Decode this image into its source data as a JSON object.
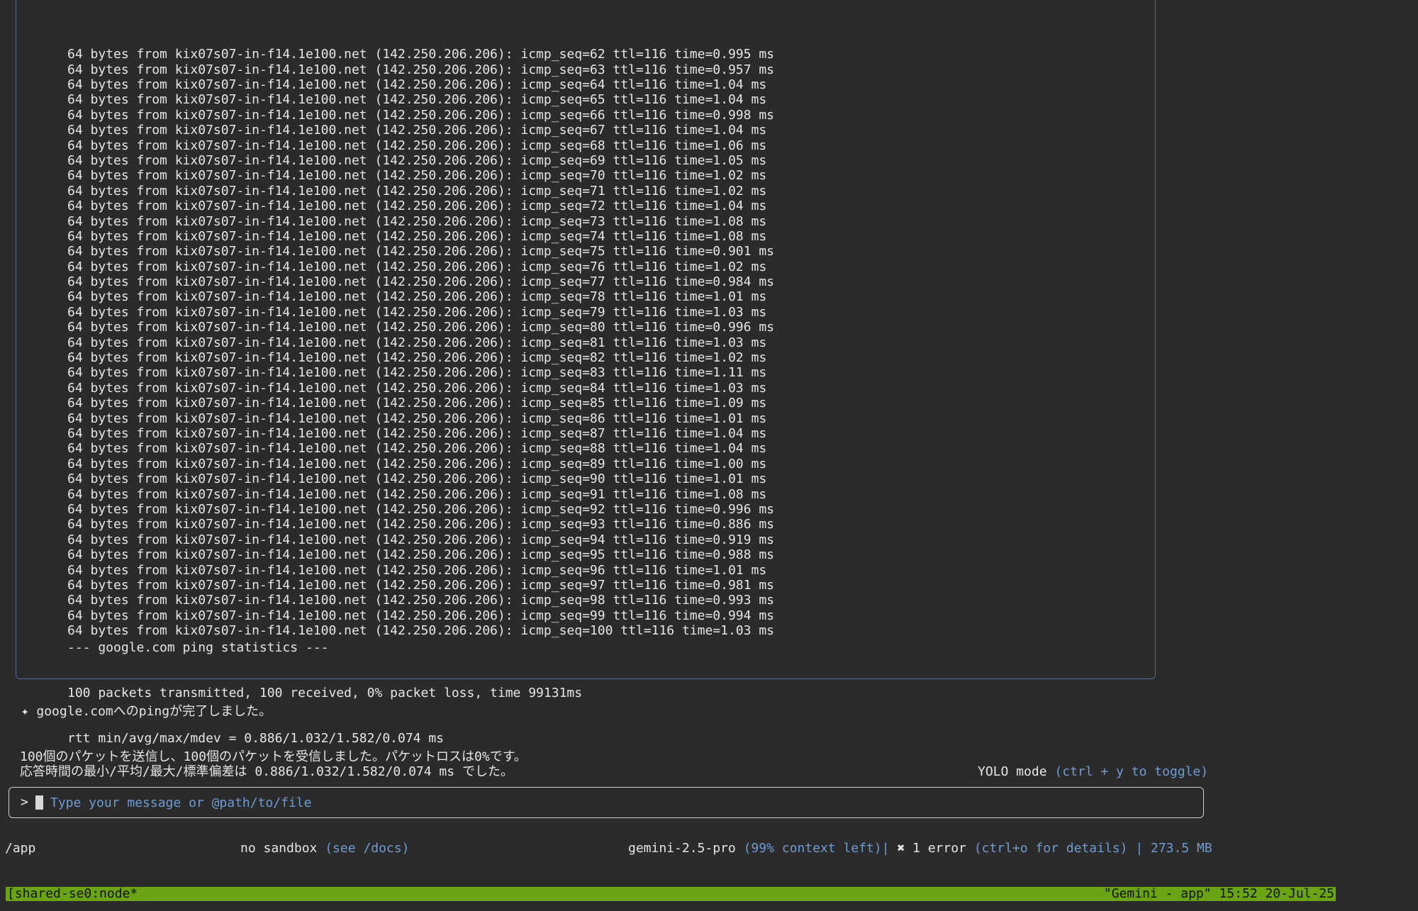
{
  "tool_output": {
    "ping_lines": [
      "64 bytes from kix07s07-in-f14.1e100.net (142.250.206.206): icmp_seq=62 ttl=116 time=0.995 ms",
      "64 bytes from kix07s07-in-f14.1e100.net (142.250.206.206): icmp_seq=63 ttl=116 time=0.957 ms",
      "64 bytes from kix07s07-in-f14.1e100.net (142.250.206.206): icmp_seq=64 ttl=116 time=1.04 ms",
      "64 bytes from kix07s07-in-f14.1e100.net (142.250.206.206): icmp_seq=65 ttl=116 time=1.04 ms",
      "64 bytes from kix07s07-in-f14.1e100.net (142.250.206.206): icmp_seq=66 ttl=116 time=0.998 ms",
      "64 bytes from kix07s07-in-f14.1e100.net (142.250.206.206): icmp_seq=67 ttl=116 time=1.04 ms",
      "64 bytes from kix07s07-in-f14.1e100.net (142.250.206.206): icmp_seq=68 ttl=116 time=1.06 ms",
      "64 bytes from kix07s07-in-f14.1e100.net (142.250.206.206): icmp_seq=69 ttl=116 time=1.05 ms",
      "64 bytes from kix07s07-in-f14.1e100.net (142.250.206.206): icmp_seq=70 ttl=116 time=1.02 ms",
      "64 bytes from kix07s07-in-f14.1e100.net (142.250.206.206): icmp_seq=71 ttl=116 time=1.02 ms",
      "64 bytes from kix07s07-in-f14.1e100.net (142.250.206.206): icmp_seq=72 ttl=116 time=1.04 ms",
      "64 bytes from kix07s07-in-f14.1e100.net (142.250.206.206): icmp_seq=73 ttl=116 time=1.08 ms",
      "64 bytes from kix07s07-in-f14.1e100.net (142.250.206.206): icmp_seq=74 ttl=116 time=1.08 ms",
      "64 bytes from kix07s07-in-f14.1e100.net (142.250.206.206): icmp_seq=75 ttl=116 time=0.901 ms",
      "64 bytes from kix07s07-in-f14.1e100.net (142.250.206.206): icmp_seq=76 ttl=116 time=1.02 ms",
      "64 bytes from kix07s07-in-f14.1e100.net (142.250.206.206): icmp_seq=77 ttl=116 time=0.984 ms",
      "64 bytes from kix07s07-in-f14.1e100.net (142.250.206.206): icmp_seq=78 ttl=116 time=1.01 ms",
      "64 bytes from kix07s07-in-f14.1e100.net (142.250.206.206): icmp_seq=79 ttl=116 time=1.03 ms",
      "64 bytes from kix07s07-in-f14.1e100.net (142.250.206.206): icmp_seq=80 ttl=116 time=0.996 ms",
      "64 bytes from kix07s07-in-f14.1e100.net (142.250.206.206): icmp_seq=81 ttl=116 time=1.03 ms",
      "64 bytes from kix07s07-in-f14.1e100.net (142.250.206.206): icmp_seq=82 ttl=116 time=1.02 ms",
      "64 bytes from kix07s07-in-f14.1e100.net (142.250.206.206): icmp_seq=83 ttl=116 time=1.11 ms",
      "64 bytes from kix07s07-in-f14.1e100.net (142.250.206.206): icmp_seq=84 ttl=116 time=1.03 ms",
      "64 bytes from kix07s07-in-f14.1e100.net (142.250.206.206): icmp_seq=85 ttl=116 time=1.09 ms",
      "64 bytes from kix07s07-in-f14.1e100.net (142.250.206.206): icmp_seq=86 ttl=116 time=1.01 ms",
      "64 bytes from kix07s07-in-f14.1e100.net (142.250.206.206): icmp_seq=87 ttl=116 time=1.04 ms",
      "64 bytes from kix07s07-in-f14.1e100.net (142.250.206.206): icmp_seq=88 ttl=116 time=1.04 ms",
      "64 bytes from kix07s07-in-f14.1e100.net (142.250.206.206): icmp_seq=89 ttl=116 time=1.00 ms",
      "64 bytes from kix07s07-in-f14.1e100.net (142.250.206.206): icmp_seq=90 ttl=116 time=1.01 ms",
      "64 bytes from kix07s07-in-f14.1e100.net (142.250.206.206): icmp_seq=91 ttl=116 time=1.08 ms",
      "64 bytes from kix07s07-in-f14.1e100.net (142.250.206.206): icmp_seq=92 ttl=116 time=0.996 ms",
      "64 bytes from kix07s07-in-f14.1e100.net (142.250.206.206): icmp_seq=93 ttl=116 time=0.886 ms",
      "64 bytes from kix07s07-in-f14.1e100.net (142.250.206.206): icmp_seq=94 ttl=116 time=0.919 ms",
      "64 bytes from kix07s07-in-f14.1e100.net (142.250.206.206): icmp_seq=95 ttl=116 time=0.988 ms",
      "64 bytes from kix07s07-in-f14.1e100.net (142.250.206.206): icmp_seq=96 ttl=116 time=1.01 ms",
      "64 bytes from kix07s07-in-f14.1e100.net (142.250.206.206): icmp_seq=97 ttl=116 time=0.981 ms",
      "64 bytes from kix07s07-in-f14.1e100.net (142.250.206.206): icmp_seq=98 ttl=116 time=0.993 ms",
      "64 bytes from kix07s07-in-f14.1e100.net (142.250.206.206): icmp_seq=99 ttl=116 time=0.994 ms",
      "64 bytes from kix07s07-in-f14.1e100.net (142.250.206.206): icmp_seq=100 ttl=116 time=1.03 ms"
    ],
    "stats_header": "--- google.com ping statistics ---",
    "stats_summary": "100 packets transmitted, 100 received, 0% packet loss, time 99131ms",
    "stats_rtt": "rtt min/avg/max/mdev = 0.886/1.032/1.582/0.074 ms"
  },
  "assistant": {
    "marker": "✦",
    "headline": "google.comへのpingが完了しました。",
    "line1": "100個のパケットを送信し、100個のパケットを受信しました。パケットロスは0%です。",
    "line2": "応答時間の最小/平均/最大/標準偏差は 0.886/1.032/1.582/0.074 ms でした。"
  },
  "mode": {
    "label": "YOLO mode",
    "hint": "(ctrl + y to toggle)"
  },
  "input": {
    "prompt": ">",
    "placeholder": "Type your message or @path/to/file",
    "value": ""
  },
  "footer": {
    "cwd": "/app",
    "sandbox_label": "no sandbox",
    "sandbox_hint": "(see /docs)",
    "model": "gemini-2.5-pro",
    "context": "(99% context left)",
    "separator": "|",
    "error_icon": "✖",
    "error_label": "1 error",
    "error_hint": "(ctrl+o for details)",
    "memory": "| 273.5 MB"
  },
  "tmux": {
    "session": "[shared-se0:node*",
    "title": "\"Gemini - app\" 15:52 20-Jul-25"
  },
  "colors": {
    "background": "#2b2b2b",
    "text": "#e6e6e6",
    "accent_blue": "#6f9bd4",
    "tmux_green": "#6aa313"
  }
}
